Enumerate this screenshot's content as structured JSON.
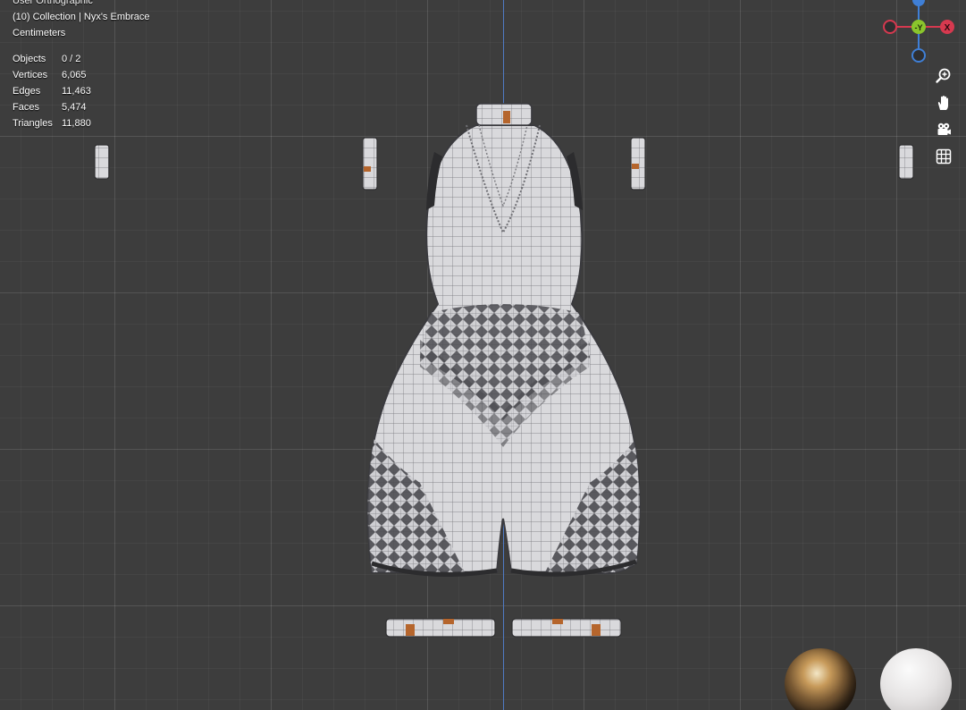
{
  "viewport": {
    "header_partial": "User Orthographic",
    "collection": "(10) Collection | Nyx's Embrace",
    "units": "Centimeters",
    "stats": [
      {
        "label": "Objects",
        "value": "0 / 2"
      },
      {
        "label": "Vertices",
        "value": "6,065"
      },
      {
        "label": "Edges",
        "value": "11,463"
      },
      {
        "label": "Faces",
        "value": "5,474"
      },
      {
        "label": "Triangles",
        "value": "11,880"
      }
    ]
  },
  "gizmo": {
    "x_label": "X",
    "y_label": "-Y",
    "x_color": "#d6394f",
    "y_color": "#8ac52c",
    "z_color": "#3f7fd6"
  },
  "nav_tools": [
    {
      "name": "zoom-icon"
    },
    {
      "name": "hand-pan-icon"
    },
    {
      "name": "camera-view-icon"
    },
    {
      "name": "ortho-grid-icon"
    }
  ],
  "scene": {
    "object": "bodysuit-mesh",
    "material_preview": [
      "hdri-studio-sphere",
      "matcap-white-sphere"
    ]
  }
}
